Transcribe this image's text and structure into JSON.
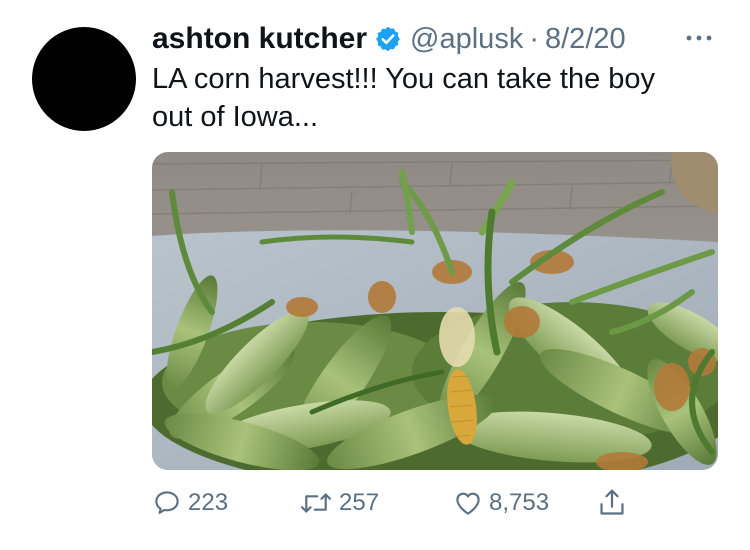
{
  "tweet": {
    "display_name": "ashton kutcher",
    "handle": "@aplusk",
    "separator": "·",
    "date": "8/2/20",
    "text_line1": "LA corn harvest!!! You can take the boy",
    "text_line2": "out of Iowa..."
  },
  "actions": {
    "replies": "223",
    "retweets": "257",
    "likes": "8,753"
  },
  "icons": {
    "verified": "verified-badge-icon",
    "more": "more-options-icon",
    "reply": "reply-bubble-icon",
    "retweet": "retweet-icon",
    "like": "heart-icon",
    "share": "share-icon"
  },
  "colors": {
    "verified_blue": "#1da1f2",
    "secondary_text": "#5b7083",
    "primary_text": "#0f1419"
  }
}
